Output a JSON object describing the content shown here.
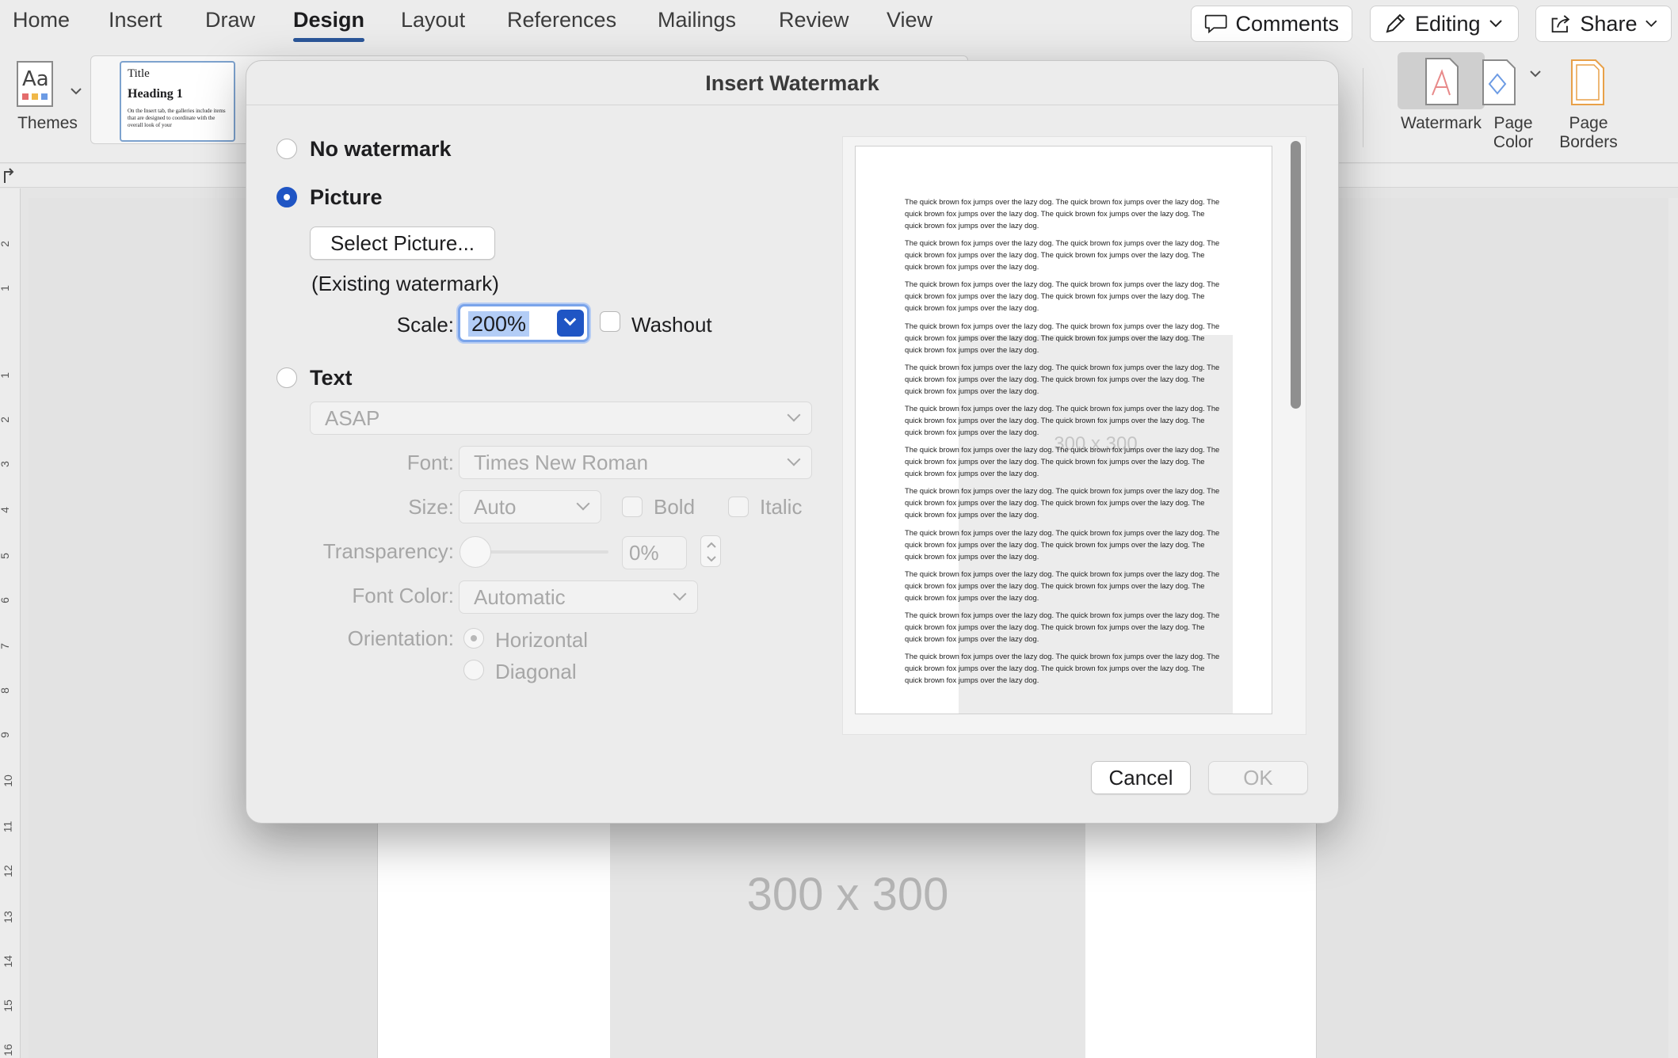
{
  "ribbon": {
    "tabs": [
      "Home",
      "Insert",
      "Draw",
      "Design",
      "Layout",
      "References",
      "Mailings",
      "Review",
      "View"
    ],
    "active_tab": "Design",
    "comments_label": "Comments",
    "editing_label": "Editing",
    "share_label": "Share",
    "themes_label": "Themes",
    "style_preview": {
      "title": "Title",
      "heading": "Heading 1",
      "body": "On the Insert tab, the galleries include items that are designed to coordinate with the overall look of your"
    },
    "watermark_label": "Watermark",
    "page_color_line1": "Page",
    "page_color_line2": "Color",
    "page_borders_line1": "Page",
    "page_borders_line2": "Borders"
  },
  "document": {
    "placeholder_text": "300 x 300",
    "ruler_numbers": [
      "2",
      "1",
      "1",
      "2",
      "3",
      "4",
      "5",
      "6",
      "7",
      "8",
      "9",
      "10",
      "11",
      "12",
      "13",
      "14",
      "15",
      "16"
    ]
  },
  "dialog": {
    "title": "Insert Watermark",
    "no_watermark_label": "No watermark",
    "picture_label": "Picture",
    "select_picture_label": "Select Picture...",
    "existing_label": "(Existing watermark)",
    "scale_label": "Scale:",
    "scale_value": "200%",
    "washout_label": "Washout",
    "text_label": "Text",
    "text_value": "ASAP",
    "font_label": "Font:",
    "font_value": "Times New Roman",
    "size_label": "Size:",
    "size_value": "Auto",
    "bold_label": "Bold",
    "italic_label": "Italic",
    "transparency_label": "Transparency:",
    "transparency_value": "0%",
    "font_color_label": "Font Color:",
    "font_color_value": "Automatic",
    "orientation_label": "Orientation:",
    "horizontal_label": "Horizontal",
    "diagonal_label": "Diagonal",
    "cancel_label": "Cancel",
    "ok_label": "OK",
    "preview": {
      "paragraph": "The quick brown fox jumps over the lazy dog. The quick brown fox jumps over the lazy dog. The quick brown fox jumps over the lazy dog. The quick brown fox jumps over the lazy dog. The quick brown fox jumps over the lazy dog.",
      "paragraph_count": 12,
      "placeholder_text": "300 x 300"
    }
  },
  "colors": {
    "accent": "#1f55c4",
    "tab_underline": "#2b579a"
  }
}
